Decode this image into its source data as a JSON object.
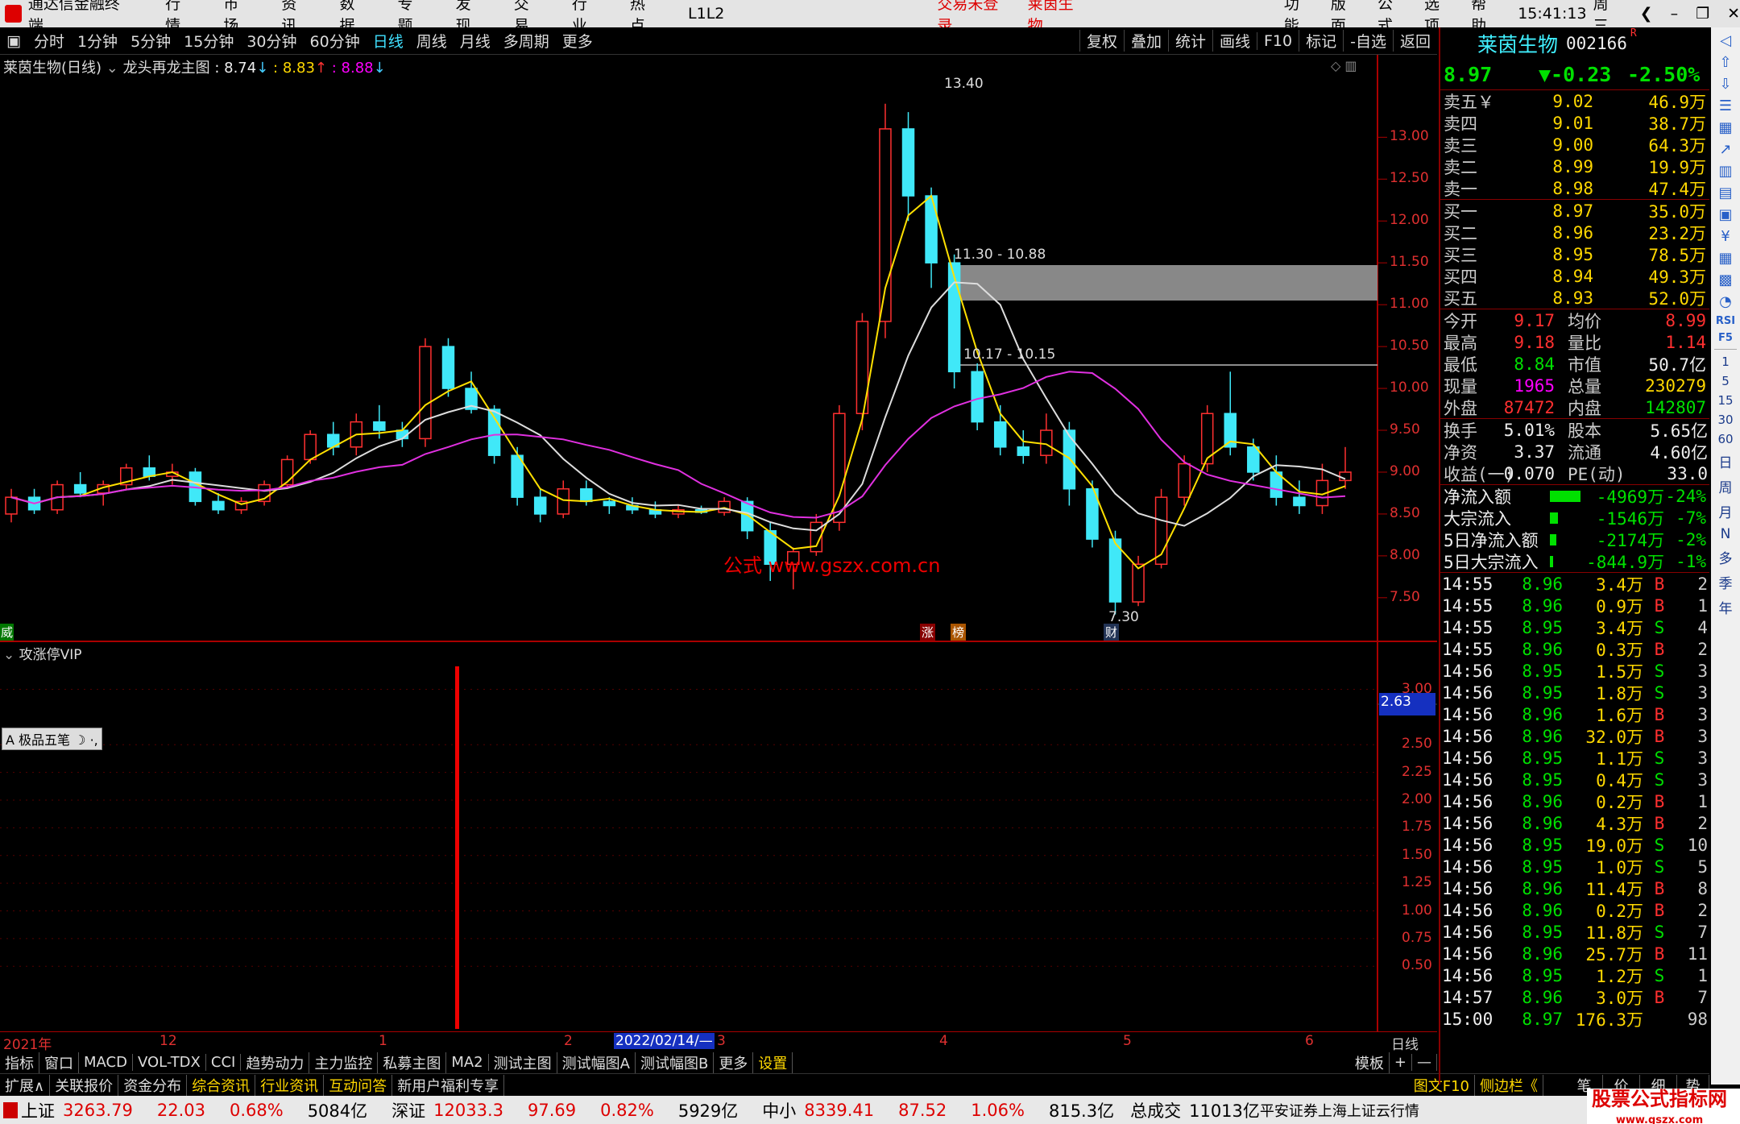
{
  "titlebar": {
    "app": "通达信金融终端",
    "menu": [
      "行情",
      "市场",
      "资讯",
      "数据",
      "专题",
      "发现",
      "交易",
      "行业",
      "热点",
      "L1L2"
    ],
    "center": [
      "交易未登录",
      "莱茵生物"
    ],
    "right": [
      "功能",
      "版面",
      "公式",
      "选项",
      "帮助"
    ],
    "time": "15:41:13",
    "weekday": "周三"
  },
  "periods": [
    "分时",
    "1分钟",
    "5分钟",
    "15分钟",
    "30分钟",
    "60分钟",
    "日线",
    "周线",
    "月线",
    "多周期",
    "更多"
  ],
  "tools": [
    "复权",
    "叠加",
    "统计",
    "画线",
    "F10",
    "标记",
    "-自选",
    "返回"
  ],
  "chart": {
    "title": "莱茵生物(日线)",
    "indicator": "龙头再龙主图",
    "v1": ": 8.74",
    "v2": ": 8.83",
    "v3": ": 8.88",
    "sub_title": "攻涨停VIP",
    "sub_value": "2.63",
    "drawtool": "极品五笔",
    "watermark": "公式   www.gszx.com.cn",
    "peak_label": "13.40",
    "low_label": "7.30",
    "zone1": "11.30 - 10.88",
    "zone2": "10.17 - 10.15",
    "mark_left": "威",
    "mark_zhang": "涨",
    "mark_bang": "榜",
    "mark_cai": "财",
    "yticks": [
      "13.00",
      "12.50",
      "12.00",
      "11.50",
      "11.00",
      "10.50",
      "10.00",
      "9.50",
      "9.00",
      "8.50",
      "8.00",
      "7.50"
    ],
    "yticks2": [
      "3.00",
      "2.50",
      "2.25",
      "2.00",
      "1.75",
      "1.50",
      "1.25",
      "1.00",
      "0.75",
      "0.50"
    ],
    "xlabels": [
      "2021年",
      "12",
      "1",
      "2",
      "2022/02/14/—",
      "3",
      "4",
      "5",
      "6"
    ],
    "x_right": "日线"
  },
  "chart_data": {
    "type": "candlestick",
    "title": "莱茵生物(日线)",
    "yrange": [
      7.2,
      13.6
    ],
    "candles": [
      [
        8.5,
        8.8,
        8.4,
        8.7
      ],
      [
        8.7,
        8.8,
        8.5,
        8.55
      ],
      [
        8.55,
        8.9,
        8.5,
        8.85
      ],
      [
        8.85,
        9.0,
        8.7,
        8.75
      ],
      [
        8.75,
        8.9,
        8.6,
        8.85
      ],
      [
        8.85,
        9.1,
        8.8,
        9.05
      ],
      [
        9.05,
        9.2,
        8.9,
        8.95
      ],
      [
        8.95,
        9.1,
        8.85,
        9.0
      ],
      [
        9.0,
        9.05,
        8.6,
        8.65
      ],
      [
        8.65,
        8.75,
        8.5,
        8.55
      ],
      [
        8.55,
        8.7,
        8.5,
        8.65
      ],
      [
        8.65,
        8.9,
        8.6,
        8.85
      ],
      [
        8.85,
        9.2,
        8.8,
        9.15
      ],
      [
        9.15,
        9.5,
        9.1,
        9.45
      ],
      [
        9.45,
        9.6,
        9.2,
        9.3
      ],
      [
        9.3,
        9.7,
        9.2,
        9.6
      ],
      [
        9.6,
        9.8,
        9.4,
        9.5
      ],
      [
        9.5,
        9.6,
        9.3,
        9.4
      ],
      [
        9.4,
        10.6,
        9.3,
        10.5
      ],
      [
        10.5,
        10.6,
        9.9,
        10.0
      ],
      [
        10.0,
        10.2,
        9.7,
        9.75
      ],
      [
        9.75,
        9.8,
        9.1,
        9.2
      ],
      [
        9.2,
        9.3,
        8.6,
        8.7
      ],
      [
        8.7,
        8.8,
        8.4,
        8.5
      ],
      [
        8.5,
        8.9,
        8.45,
        8.8
      ],
      [
        8.8,
        8.9,
        8.6,
        8.65
      ],
      [
        8.65,
        8.7,
        8.5,
        8.6
      ],
      [
        8.6,
        8.7,
        8.5,
        8.55
      ],
      [
        8.55,
        8.65,
        8.45,
        8.5
      ],
      [
        8.5,
        8.6,
        8.45,
        8.55
      ],
      [
        8.55,
        8.6,
        8.5,
        8.52
      ],
      [
        8.52,
        8.7,
        8.48,
        8.65
      ],
      [
        8.65,
        8.7,
        8.2,
        8.3
      ],
      [
        8.3,
        8.4,
        7.7,
        7.9
      ],
      [
        7.9,
        8.1,
        7.6,
        8.05
      ],
      [
        8.05,
        8.5,
        8.0,
        8.4
      ],
      [
        8.4,
        9.8,
        8.3,
        9.7
      ],
      [
        9.7,
        10.9,
        9.5,
        10.8
      ],
      [
        10.8,
        13.4,
        10.6,
        13.1
      ],
      [
        13.1,
        13.3,
        12.0,
        12.3
      ],
      [
        12.3,
        12.4,
        11.2,
        11.5
      ],
      [
        11.5,
        11.6,
        10.0,
        10.2
      ],
      [
        10.2,
        10.3,
        9.5,
        9.6
      ],
      [
        9.6,
        9.8,
        9.2,
        9.3
      ],
      [
        9.3,
        9.5,
        9.1,
        9.2
      ],
      [
        9.2,
        9.7,
        9.1,
        9.5
      ],
      [
        9.5,
        9.6,
        8.6,
        8.8
      ],
      [
        8.8,
        8.9,
        8.1,
        8.2
      ],
      [
        8.2,
        8.3,
        7.3,
        7.45
      ],
      [
        7.45,
        8.0,
        7.4,
        7.9
      ],
      [
        7.9,
        8.8,
        7.85,
        8.7
      ],
      [
        8.7,
        9.2,
        8.6,
        9.1
      ],
      [
        9.1,
        9.8,
        9.0,
        9.7
      ],
      [
        9.7,
        10.2,
        9.2,
        9.3
      ],
      [
        9.3,
        9.4,
        8.9,
        9.0
      ],
      [
        9.0,
        9.2,
        8.6,
        8.7
      ],
      [
        8.7,
        8.9,
        8.5,
        8.6
      ],
      [
        8.6,
        9.1,
        8.5,
        8.9
      ],
      [
        8.9,
        9.3,
        8.8,
        9.0
      ]
    ]
  },
  "quote": {
    "name": "莱茵生物",
    "code": "002166",
    "r": "R",
    "price": "8.97",
    "change": "▼-0.23",
    "pct": "-2.50%",
    "sells": [
      [
        "卖五￥",
        "9.02",
        "46.9万"
      ],
      [
        "卖四",
        "9.01",
        "38.7万"
      ],
      [
        "卖三",
        "9.00",
        "64.3万"
      ],
      [
        "卖二",
        "8.99",
        "19.9万"
      ],
      [
        "卖一",
        "8.98",
        "47.4万"
      ]
    ],
    "buys": [
      [
        "买一",
        "8.97",
        "35.0万"
      ],
      [
        "买二",
        "8.96",
        "23.2万"
      ],
      [
        "买三",
        "8.95",
        "78.5万"
      ],
      [
        "买四",
        "8.94",
        "49.3万"
      ],
      [
        "买五",
        "8.93",
        "52.0万"
      ]
    ],
    "stats": [
      [
        "今开",
        "9.17",
        "均价",
        "8.99"
      ],
      [
        "最高",
        "9.18",
        "量比",
        "1.14"
      ],
      [
        "最低",
        "8.84",
        "市值",
        "50.7亿"
      ],
      [
        "现量",
        "1965",
        "总量",
        "230279"
      ],
      [
        "外盘",
        "87472",
        "内盘",
        "142807"
      ]
    ],
    "fund": [
      [
        "换手",
        "5.01%",
        "股本",
        "5.65亿"
      ],
      [
        "净资",
        "3.37",
        "流通",
        "4.60亿"
      ],
      [
        "收益(一)",
        "0.070",
        "PE(动)",
        "33.0"
      ]
    ],
    "flows": [
      [
        "净流入额",
        "-4969万",
        "-24%"
      ],
      [
        "大宗流入",
        "-1546万",
        "-7%"
      ],
      [
        "5日净流入额",
        "-2174万",
        "-2%"
      ],
      [
        "5日大宗流入",
        "-844.9万",
        "-1%"
      ]
    ],
    "ticks": [
      [
        "14:55",
        "8.96",
        "3.4万",
        "B",
        "2"
      ],
      [
        "14:55",
        "8.96",
        "0.9万",
        "B",
        "1"
      ],
      [
        "14:55",
        "8.95",
        "3.4万",
        "S",
        "4"
      ],
      [
        "14:55",
        "8.96",
        "0.3万",
        "B",
        "2"
      ],
      [
        "14:56",
        "8.95",
        "1.5万",
        "S",
        "3"
      ],
      [
        "14:56",
        "8.95",
        "1.8万",
        "S",
        "3"
      ],
      [
        "14:56",
        "8.96",
        "1.6万",
        "B",
        "3"
      ],
      [
        "14:56",
        "8.96",
        "32.0万",
        "B",
        "3"
      ],
      [
        "14:56",
        "8.95",
        "1.1万",
        "S",
        "3"
      ],
      [
        "14:56",
        "8.95",
        "0.4万",
        "S",
        "3"
      ],
      [
        "14:56",
        "8.96",
        "0.2万",
        "B",
        "1"
      ],
      [
        "14:56",
        "8.96",
        "4.3万",
        "B",
        "2"
      ],
      [
        "14:56",
        "8.95",
        "19.0万",
        "S",
        "10"
      ],
      [
        "14:56",
        "8.95",
        "1.0万",
        "S",
        "5"
      ],
      [
        "14:56",
        "8.96",
        "11.4万",
        "B",
        "8"
      ],
      [
        "14:56",
        "8.96",
        "0.2万",
        "B",
        "2"
      ],
      [
        "14:56",
        "8.95",
        "11.8万",
        "S",
        "7"
      ],
      [
        "14:56",
        "8.96",
        "25.7万",
        "B",
        "11"
      ],
      [
        "14:56",
        "8.95",
        "1.2万",
        "S",
        "1"
      ],
      [
        "14:57",
        "8.96",
        "3.0万",
        "B",
        "7"
      ],
      [
        "15:00",
        "8.97",
        "176.3万",
        "",
        "98"
      ]
    ]
  },
  "sidebar": [
    "日",
    "周",
    "月",
    "N",
    "多",
    "季",
    "年"
  ],
  "sidebar_nums": [
    "1",
    "5",
    "15",
    "30",
    "60"
  ],
  "sidebar_labels": [
    "RSI",
    "F5"
  ],
  "bottomtabs": [
    "指标",
    "窗口",
    "MACD",
    "VOL-TDX",
    "CCI",
    "趋势动力",
    "主力监控",
    "私募主图",
    "MA2",
    "测试主图",
    "测试幅图A",
    "测试幅图B",
    "更多",
    "设置"
  ],
  "bottomtabs_right": [
    "模板",
    "+",
    "—"
  ],
  "bottomtabs2": [
    "扩展∧",
    "关联报价",
    "资金分布",
    "综合资讯",
    "行业资讯",
    "互动问答",
    "新用户福利专享"
  ],
  "bottom2_right": [
    "图文F10",
    "侧边栏《",
    "笔",
    "价",
    "细",
    "势"
  ],
  "status": {
    "sh_label": "上证",
    "sh": "3263.79",
    "sh_chg": "22.03",
    "sh_pct": "0.68%",
    "sh_amt": "5084亿",
    "sz_label": "深证",
    "sz": "12033.3",
    "sz_chg": "97.69",
    "sz_pct": "0.82%",
    "sz_amt": "5929亿",
    "zx_label": "中小",
    "zx": "8339.41",
    "zx_chg": "87.52",
    "zx_pct": "1.06%",
    "zx_amt": "815.3亿",
    "total_label": "总成交",
    "total": "11013亿",
    "note": "平安证券上海上证云行情",
    "brand": "股票公式指标网",
    "brand_url": "www.gszx.com"
  }
}
